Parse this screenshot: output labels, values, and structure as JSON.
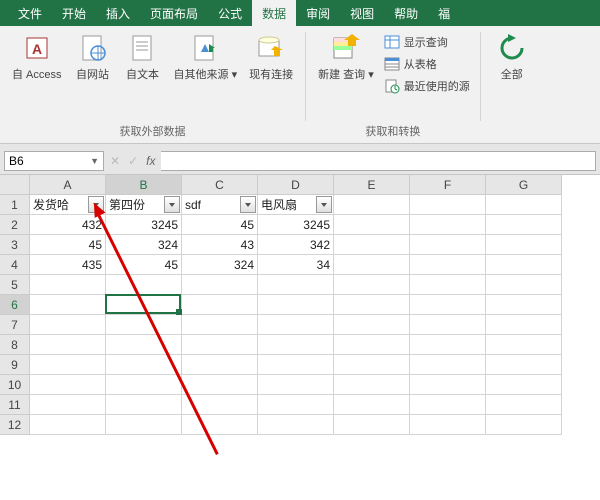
{
  "tabs": [
    "文件",
    "开始",
    "插入",
    "页面布局",
    "公式",
    "数据",
    "审阅",
    "视图",
    "帮助",
    "福"
  ],
  "active_tab_index": 5,
  "ribbon": {
    "group1": {
      "label": "获取外部数据",
      "items": [
        "自 Access",
        "自网站",
        "自文本",
        "自其他来源",
        "现有连接"
      ]
    },
    "group2": {
      "label": "获取和转换",
      "big": "新建\n查询",
      "small": [
        "显示查询",
        "从表格",
        "最近使用的源"
      ]
    },
    "group3": {
      "big": "全部"
    }
  },
  "name_box": "B6",
  "columns": [
    "A",
    "B",
    "C",
    "D",
    "E",
    "F",
    "G"
  ],
  "row_count": 12,
  "sheet": {
    "headers": [
      "发货哈",
      "第四份",
      "sdf",
      "电风扇"
    ],
    "data": [
      [
        "432",
        "3245",
        "45",
        "3245"
      ],
      [
        "45",
        "324",
        "43",
        "342"
      ],
      [
        "435",
        "45",
        "324",
        "34"
      ]
    ]
  },
  "active": {
    "col": 1,
    "row": 5
  },
  "selected_col": 1,
  "selected_row": 5
}
